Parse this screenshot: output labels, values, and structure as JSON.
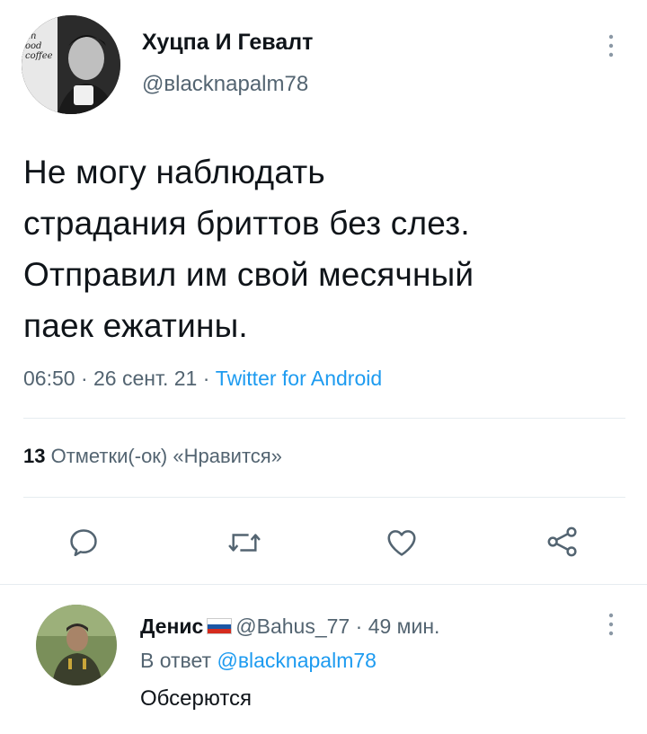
{
  "tweet": {
    "author_name": "Хуцпа И Гевалт",
    "author_handle": "@вlacknapalm78",
    "avatar_text": [
      "an",
      "ood",
      "coffee"
    ],
    "text_lines": [
      "Не могу наблюдать",
      "страдания бриттов без слез.",
      "Отправил им свой месячный",
      "паек ежатины."
    ],
    "time": "06:50",
    "date": "26 сент. 21",
    "source": "Twitter for Android",
    "likes_count": "13",
    "likes_label": "Отметки(-ок) «Нравится»"
  },
  "actions": [
    "reply-icon",
    "retweet-icon",
    "like-icon",
    "share-icon"
  ],
  "reply": {
    "author_name": "Денис",
    "flag_colors": [
      "#ffffff",
      "#1c57a5",
      "#d52b1e"
    ],
    "author_handle": "@Bahus_77",
    "time_ago": "49 мин.",
    "in_reply_prefix": "В ответ",
    "in_reply_handle": "@вlacknapalm78",
    "text": "Обсерются"
  },
  "separator": "·"
}
